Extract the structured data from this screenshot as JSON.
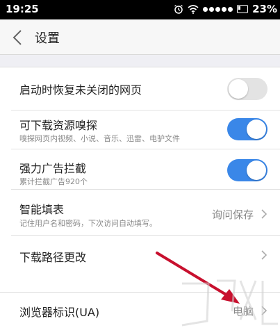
{
  "status_bar": {
    "time": "19:25",
    "battery": "23%"
  },
  "header": {
    "title": "设置"
  },
  "settings": {
    "restore_pages": {
      "title": "启动时恢复未关闭的网页",
      "enabled": false
    },
    "download_sniff": {
      "title": "可下载资源嗅探",
      "subtitle": "嗅探网页内视频、小说、音乐、迅雷、电驴文件",
      "enabled": true
    },
    "ad_block": {
      "title": "强力广告拦截",
      "subtitle": "累计拦截广告920个",
      "enabled": true
    },
    "autofill": {
      "title": "智能填表",
      "subtitle": "记住用户名和密码，下次访问自动填写。",
      "value": "询问保存"
    },
    "download_path": {
      "title": "下载路径更改"
    },
    "user_agent": {
      "title": "浏览器标识(UA)",
      "value": "电脑"
    }
  },
  "colors": {
    "accent": "#3a87e8",
    "annotation_arrow": "#c8102e"
  }
}
